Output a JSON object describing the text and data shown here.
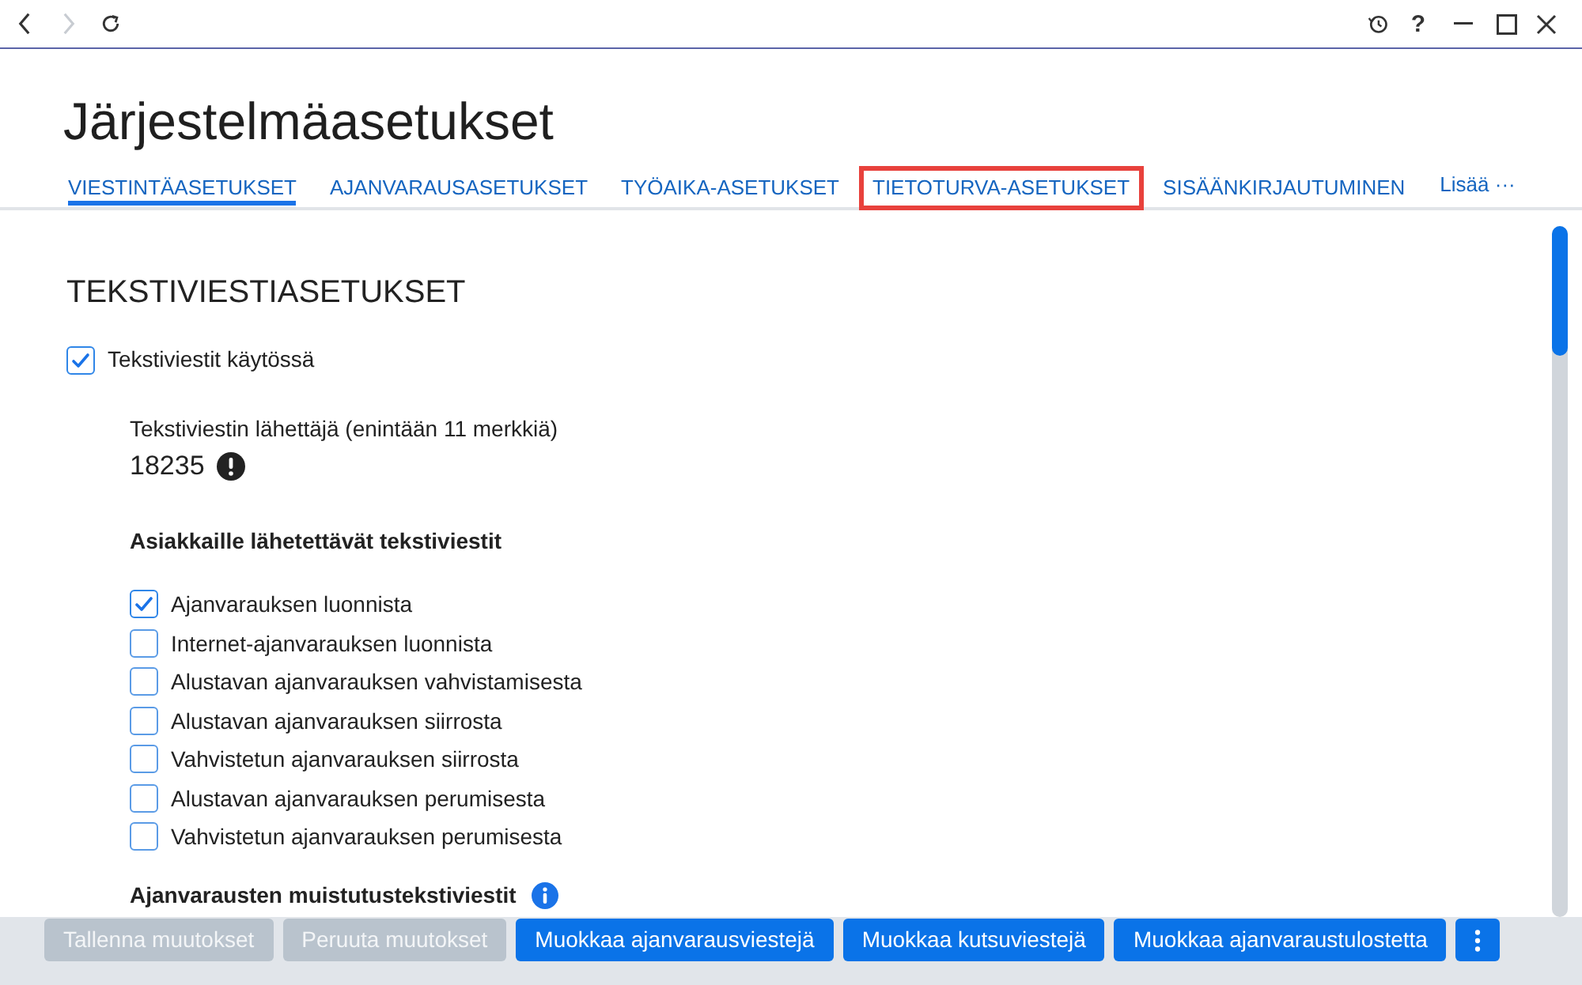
{
  "title_bar": {
    "back_enabled": true,
    "forward_enabled": false,
    "help_label": "?"
  },
  "page_title": "Järjestelmäasetukset",
  "tabs": [
    {
      "label": "VIESTINTÄASETUKSET",
      "selected": true,
      "highlighted": false
    },
    {
      "label": "AJANVARAUSASETUKSET",
      "selected": false,
      "highlighted": false
    },
    {
      "label": "TYÖAIKA-ASETUKSET",
      "selected": false,
      "highlighted": false
    },
    {
      "label": "TIETOTURVA-ASETUKSET",
      "selected": false,
      "highlighted": true
    },
    {
      "label": "SISÄÄNKIRJAUTUMINEN",
      "selected": false,
      "highlighted": false
    }
  ],
  "more_tabs": {
    "label": "Lisää",
    "dots": "···"
  },
  "section": {
    "heading": "TEKSTIVIESTIASETUKSET",
    "enable": {
      "label": "Tekstiviestit käytössä",
      "checked": true
    },
    "sender": {
      "label": "Tekstiviestin lähettäjä (enintään 11 merkkiä)",
      "value": "18235",
      "warning": true
    },
    "customer_messages": {
      "heading": "Asiakkaille lähetettävät tekstiviestit",
      "options": [
        {
          "label": "Ajanvarauksen luonnista",
          "checked": true
        },
        {
          "label": "Internet-ajanvarauksen luonnista",
          "checked": false
        },
        {
          "label": "Alustavan ajanvarauksen vahvistamisesta",
          "checked": false
        },
        {
          "label": "Alustavan ajanvarauksen siirrosta",
          "checked": false
        },
        {
          "label": "Vahvistetun ajanvarauksen siirrosta",
          "checked": false
        },
        {
          "label": "Alustavan ajanvarauksen perumisesta",
          "checked": false
        },
        {
          "label": "Vahvistetun ajanvarauksen perumisesta",
          "checked": false
        }
      ]
    },
    "reminders": {
      "heading": "Ajanvarausten muistutustekstiviestit",
      "info": true
    }
  },
  "footer_buttons": [
    {
      "label": "Tallenna muutokset",
      "disabled": true
    },
    {
      "label": "Peruuta muutokset",
      "disabled": true
    },
    {
      "label": "Muokkaa ajanvarausviestejä",
      "disabled": false
    },
    {
      "label": "Muokkaa kutsuviestejä",
      "disabled": false
    },
    {
      "label": "Muokkaa ajanvaraustulostetta",
      "disabled": false
    }
  ]
}
